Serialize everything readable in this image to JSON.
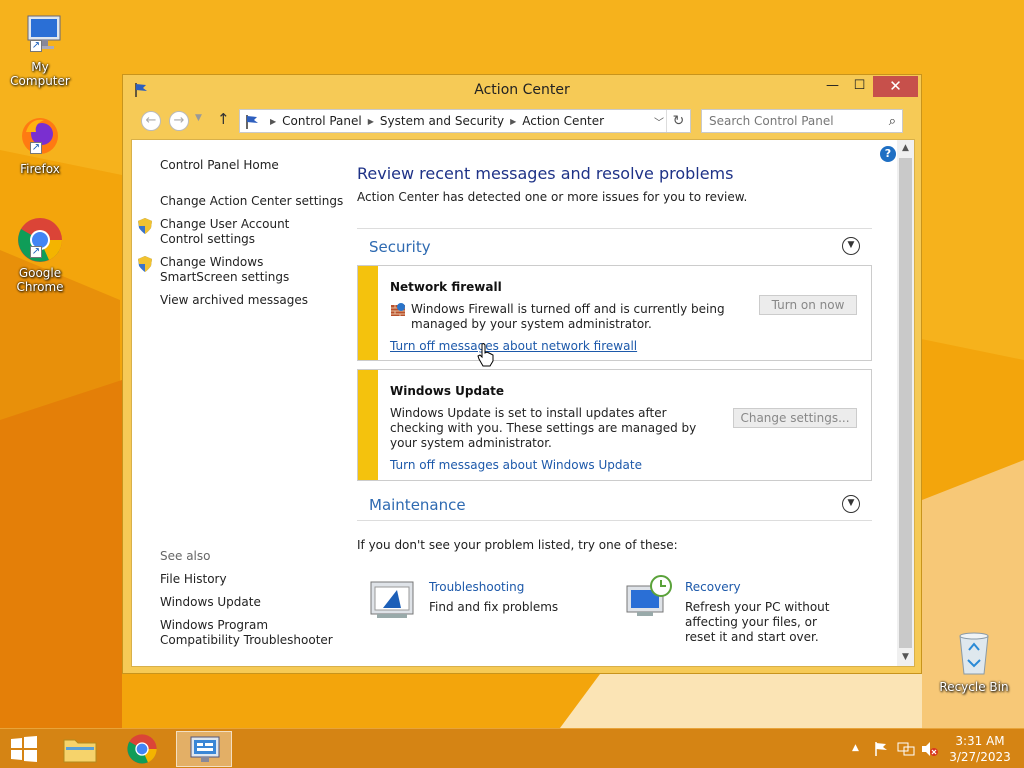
{
  "desktop": {
    "icons": [
      {
        "label": "My Computer"
      },
      {
        "label": "Firefox"
      },
      {
        "label": "Google Chrome"
      },
      {
        "label": "Recycle Bin"
      }
    ]
  },
  "window": {
    "title": "Action Center",
    "controls": {
      "minimize": "—",
      "maximize": "☐",
      "close": "✕"
    },
    "address": {
      "crumbs": [
        "Control Panel",
        "System and Security",
        "Action Center"
      ],
      "search_placeholder": "Search Control Panel"
    }
  },
  "left_pane": {
    "home": "Control Panel Home",
    "links": [
      "Change Action Center settings",
      "Change User Account Control settings",
      "Change Windows SmartScreen settings",
      "View archived messages"
    ],
    "see_also_title": "See also",
    "see_also": [
      "File History",
      "Windows Update",
      "Windows Program Compatibility Troubleshooter"
    ]
  },
  "main": {
    "title": "Review recent messages and resolve problems",
    "subtitle": "Action Center has detected one or more issues for you to review.",
    "security": {
      "heading": "Security",
      "firewall": {
        "title": "Network firewall",
        "text": "Windows Firewall is turned off and is currently being managed by your system administrator.",
        "button": "Turn on now",
        "link": "Turn off messages about network firewall"
      },
      "update": {
        "title": "Windows Update",
        "text": "Windows Update is set to install updates after checking with you.  These settings are managed by your system administrator.",
        "button": "Change settings...",
        "link": "Turn off messages about Windows Update"
      }
    },
    "maintenance": {
      "heading": "Maintenance"
    },
    "bottom_intro": "If you don't see your problem listed, try one of these:",
    "tools": [
      {
        "link": "Troubleshooting",
        "desc": "Find and fix problems"
      },
      {
        "link": "Recovery",
        "desc": "Refresh your PC without affecting your files, or reset it and start over."
      }
    ]
  },
  "taskbar": {
    "time": "3:31 AM",
    "date": "3/27/2023"
  },
  "colors": {
    "wallpaper": "#f2a20a",
    "window_frame": "#f6ca56",
    "link": "#1d59aa",
    "heading": "#2e6ab1",
    "warning_stripe": "#f4c20d",
    "close_button": "#c7504b"
  }
}
